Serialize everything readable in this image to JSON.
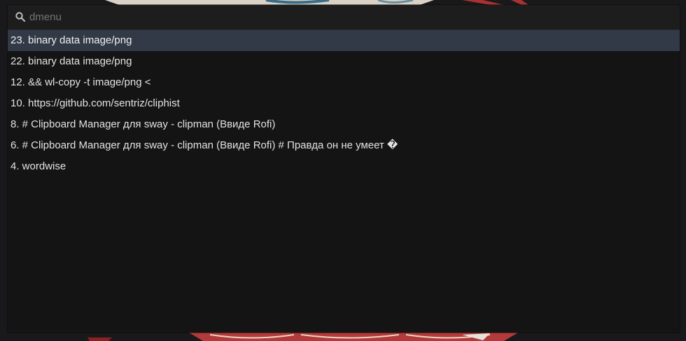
{
  "search": {
    "placeholder": "dmenu",
    "value": "",
    "icon": "search-icon"
  },
  "entries": [
    {
      "text": "23. binary data image/png",
      "selected": true
    },
    {
      "text": "22. binary data image/png",
      "selected": false
    },
    {
      "text": "12. && wl-copy -t image/png <",
      "selected": false
    },
    {
      "text": "10. https://github.com/sentriz/cliphist",
      "selected": false
    },
    {
      "text": "8. # Clipboard Manager для sway - clipman (Ввиде Rofi)",
      "selected": false
    },
    {
      "text": "6. # Clipboard Manager для sway - clipman (Ввиде Rofi) # Правда он не умеет �",
      "selected": false
    },
    {
      "text": "4. wordwise",
      "selected": false
    }
  ],
  "colors": {
    "panel_bg": "#141414",
    "search_bg": "#1d1d1d",
    "selected_bg": "#323a47",
    "text": "#e2e2e2"
  }
}
